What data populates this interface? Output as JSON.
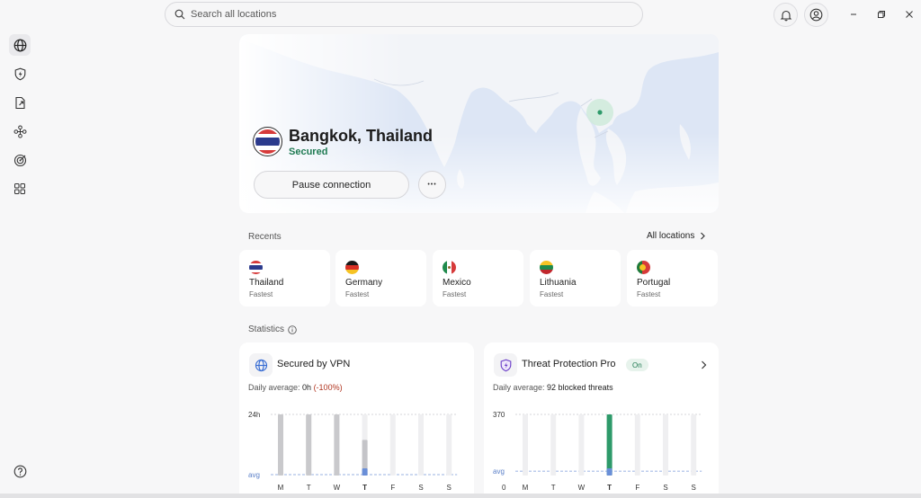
{
  "search": {
    "placeholder": "Search all locations"
  },
  "icons": {
    "search": "search-icon",
    "bell": "bell-icon",
    "account": "account-icon",
    "minimize": "minimize-icon",
    "restore": "restore-icon",
    "close": "close-icon"
  },
  "sidebar": {
    "items": [
      {
        "name": "globe-icon",
        "active": true
      },
      {
        "name": "shield-icon",
        "active": false
      },
      {
        "name": "file-icon",
        "active": false
      },
      {
        "name": "mesh-icon",
        "active": false
      },
      {
        "name": "radar-icon",
        "active": false
      },
      {
        "name": "apps-icon",
        "active": false
      }
    ],
    "help": "help-icon"
  },
  "connection": {
    "location": "Bangkok, Thailand",
    "status": "Secured",
    "pause_label": "Pause connection",
    "more_label": "•••"
  },
  "recents": {
    "label": "Recents",
    "all_label": "All locations",
    "items": [
      {
        "country": "Thailand",
        "sub": "Fastest"
      },
      {
        "country": "Germany",
        "sub": "Fastest"
      },
      {
        "country": "Mexico",
        "sub": "Fastest"
      },
      {
        "country": "Lithuania",
        "sub": "Fastest"
      },
      {
        "country": "Portugal",
        "sub": "Fastest"
      }
    ]
  },
  "statistics": {
    "label": "Statistics",
    "vpn": {
      "title": "Secured by VPN",
      "avg_prefix": "Daily average: ",
      "avg_value": "0h",
      "avg_change": "(-100%)",
      "chart_data": {
        "type": "bar",
        "categories": [
          "M",
          "T",
          "W",
          "T",
          "F",
          "S",
          "S"
        ],
        "ymax_label": "24h",
        "avg_label": "avg",
        "ylim": [
          0,
          24
        ],
        "series": [
          {
            "values": [
              24,
              24,
              24,
              14,
              0,
              0,
              0
            ]
          },
          {
            "values": [
              0,
              0,
              0,
              1,
              0,
              0,
              0
            ]
          }
        ],
        "highlight_index": 3
      }
    },
    "threat": {
      "title": "Threat Protection Pro",
      "badge": "On",
      "avg_prefix": "Daily average: ",
      "avg_value": "92 blocked threats",
      "chart_data": {
        "type": "bar",
        "categories": [
          "M",
          "T",
          "W",
          "T",
          "F",
          "S",
          "S"
        ],
        "ymax_label": "370",
        "avg_label": "avg",
        "zero_label": "0",
        "ylim": [
          0,
          370
        ],
        "avg": 92,
        "series": [
          {
            "values": [
              0,
              0,
              0,
              370,
              0,
              0,
              0
            ]
          }
        ],
        "highlight_index": 3
      }
    }
  },
  "colors": {
    "accent_green": "#2e9a6a",
    "secure_text": "#1f7a52",
    "bar_blue": "#6a8fd8",
    "bar_gray": "#d3d3d6"
  }
}
